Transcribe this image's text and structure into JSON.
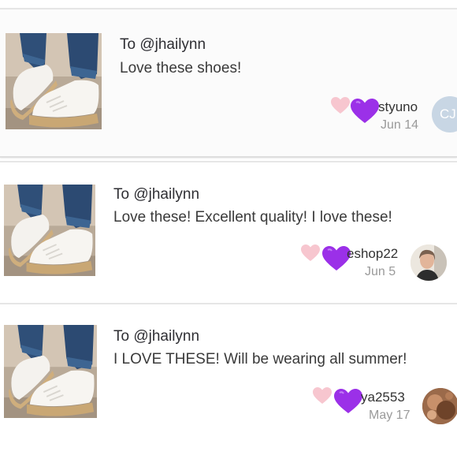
{
  "comments": [
    {
      "to": "To @jhailynn",
      "message": "Love these shoes!",
      "username": "styuno",
      "date": "Jun 14",
      "avatar_initials": "CJ"
    },
    {
      "to": "To @jhailynn",
      "message": "Love these! Excellent quality! I love these!",
      "username": "eshop22",
      "date": "Jun 5",
      "avatar_initials": ""
    },
    {
      "to": "To @jhailynn",
      "message": "I LOVE THESE! Will be wearing all summer!",
      "username": "ya2553",
      "date": "May 17",
      "avatar_initials": ""
    }
  ],
  "colors": {
    "pink_heart": "#f7c6cf",
    "purple_heart": "#9b30e8",
    "date": "#9a9a9a"
  },
  "icons": {
    "pink": "heart-icon",
    "purple": "purple-heart-emoji-icon"
  }
}
